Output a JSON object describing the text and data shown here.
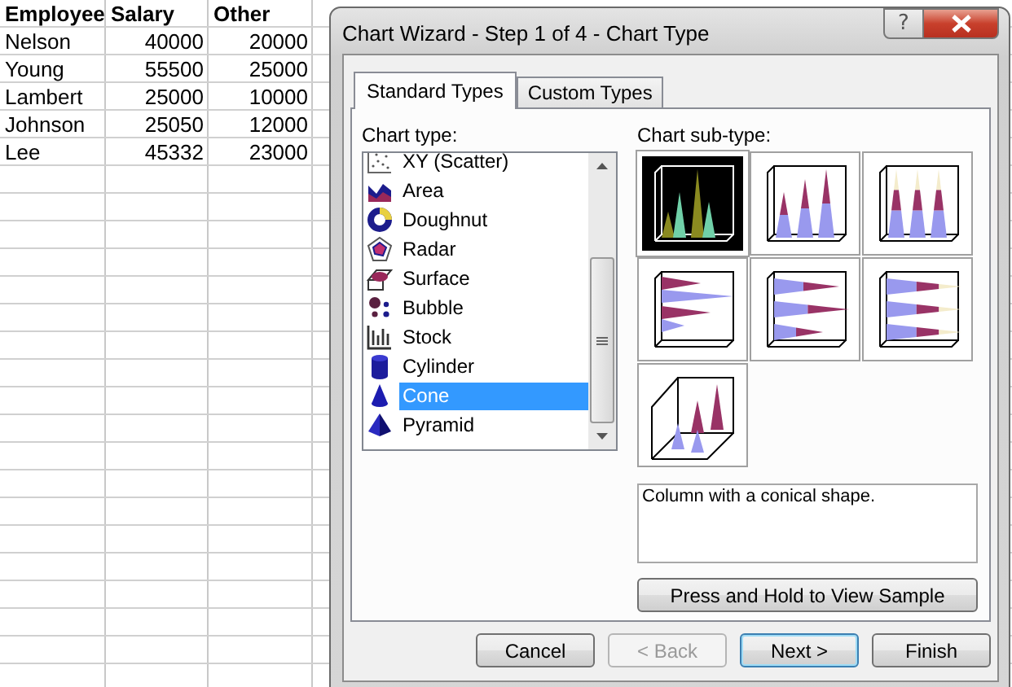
{
  "spreadsheet": {
    "columns": [
      "Employee",
      "Salary",
      "Other"
    ],
    "rows": [
      [
        "Nelson",
        "40000",
        "20000"
      ],
      [
        "Young",
        "55500",
        "25000"
      ],
      [
        "Lambert",
        "25000",
        "10000"
      ],
      [
        "Johnson",
        "25050",
        "12000"
      ],
      [
        "Lee",
        "45332",
        "23000"
      ]
    ]
  },
  "dialog": {
    "title": "Chart Wizard - Step 1 of 4 - Chart Type",
    "help_button": "?",
    "tabs": [
      {
        "label": "Standard Types",
        "selected": true
      },
      {
        "label": "Custom Types",
        "selected": false
      }
    ],
    "chart_type_label": "Chart type:",
    "chart_types": [
      {
        "label": "XY (Scatter)",
        "kind": "scatter",
        "selected": false
      },
      {
        "label": "Area",
        "kind": "area",
        "selected": false
      },
      {
        "label": "Doughnut",
        "kind": "doughnut",
        "selected": false
      },
      {
        "label": "Radar",
        "kind": "radar",
        "selected": false
      },
      {
        "label": "Surface",
        "kind": "surface",
        "selected": false
      },
      {
        "label": "Bubble",
        "kind": "bubble",
        "selected": false
      },
      {
        "label": "Stock",
        "kind": "stock",
        "selected": false
      },
      {
        "label": "Cylinder",
        "kind": "cylinder",
        "selected": false
      },
      {
        "label": "Cone",
        "kind": "cone",
        "selected": true
      },
      {
        "label": "Pyramid",
        "kind": "pyramid",
        "selected": false
      }
    ],
    "subtype_label": "Chart sub-type:",
    "subtypes": [
      {
        "kind": "clustered",
        "selected": true
      },
      {
        "kind": "stacked",
        "selected": false
      },
      {
        "kind": "stacked100",
        "selected": false
      },
      {
        "kind": "clusteredbar",
        "selected": false
      },
      {
        "kind": "stackedbar",
        "selected": false
      },
      {
        "kind": "stacked100bar",
        "selected": false
      },
      {
        "kind": "perspective",
        "selected": false
      }
    ],
    "description": "Column with a conical shape.",
    "sample_button": "Press and Hold to View Sample",
    "buttons": [
      {
        "label": "Cancel",
        "disabled": false,
        "default": false
      },
      {
        "label": "< Back",
        "disabled": true,
        "default": false
      },
      {
        "label": "Next >",
        "disabled": false,
        "default": true
      },
      {
        "label": "Finish",
        "disabled": false,
        "default": false
      }
    ]
  }
}
